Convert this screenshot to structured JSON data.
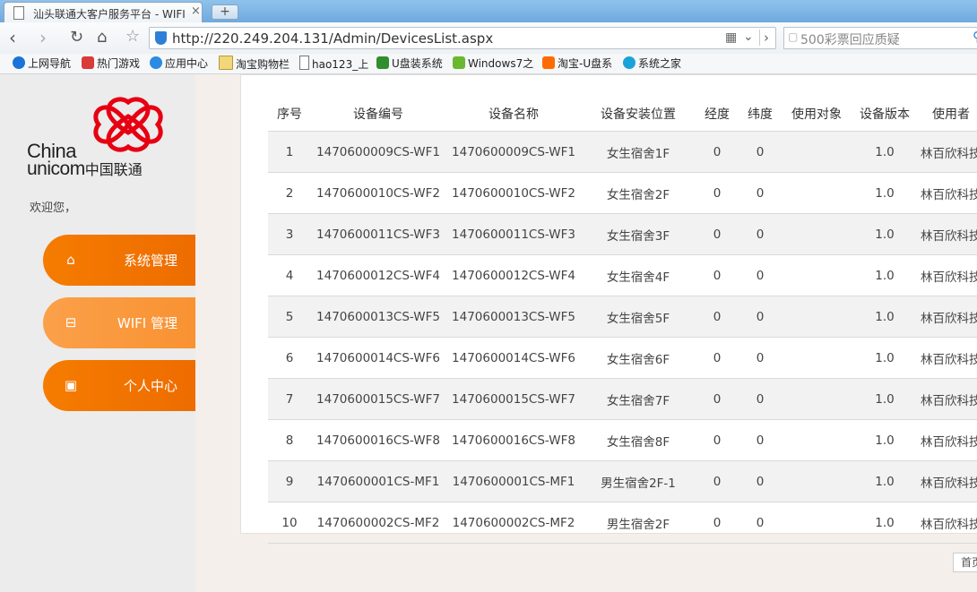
{
  "browser": {
    "tab_title": "汕头联通大客户服务平台 - WIFI",
    "tab_close": "×",
    "new_tab": "+",
    "url": "http://220.249.204.131/Admin/DevicesList.aspx",
    "search_placeholder": "500彩票回应质疑",
    "bookmarks": [
      {
        "label": "上网导航",
        "color": "#1a73d9"
      },
      {
        "label": "热门游戏",
        "color": "#d93a3a"
      },
      {
        "label": "应用中心",
        "color": "#2a8be0"
      },
      {
        "label": "淘宝购物栏",
        "color": "#f1d67a"
      },
      {
        "label": "hao123_上",
        "color": "#ffffff"
      },
      {
        "label": "U盘装系统",
        "color": "#2f8f2f"
      },
      {
        "label": "Windows7之",
        "color": "#6ab82f"
      },
      {
        "label": "淘宝-U盘系",
        "color": "#ff6a00"
      },
      {
        "label": "系统之家",
        "color": "#1aa3d9"
      }
    ]
  },
  "sidebar": {
    "logo_china": "China",
    "logo_unicom": "unicom",
    "logo_cn": "中国联通",
    "welcome": "欢迎您，",
    "menu": [
      {
        "label": "系统管理",
        "icon": "home-icon",
        "glyph": "⌂"
      },
      {
        "label": "WIFI 管理",
        "icon": "inbox-icon",
        "glyph": "⊟"
      },
      {
        "label": "个人中心",
        "icon": "briefcase-icon",
        "glyph": "▣"
      }
    ]
  },
  "table": {
    "headers": [
      "序号",
      "设备编号",
      "设备名称",
      "设备安装位置",
      "经度",
      "纬度",
      "使用对象",
      "设备版本",
      "使用者"
    ],
    "rows": [
      [
        "1",
        "1470600009CS-WF1",
        "1470600009CS-WF1",
        "女生宿舍1F",
        "0",
        "0",
        "",
        "1.0",
        "林百欣科技中"
      ],
      [
        "2",
        "1470600010CS-WF2",
        "1470600010CS-WF2",
        "女生宿舍2F",
        "0",
        "0",
        "",
        "1.0",
        "林百欣科技中"
      ],
      [
        "3",
        "1470600011CS-WF3",
        "1470600011CS-WF3",
        "女生宿舍3F",
        "0",
        "0",
        "",
        "1.0",
        "林百欣科技中"
      ],
      [
        "4",
        "1470600012CS-WF4",
        "1470600012CS-WF4",
        "女生宿舍4F",
        "0",
        "0",
        "",
        "1.0",
        "林百欣科技中"
      ],
      [
        "5",
        "1470600013CS-WF5",
        "1470600013CS-WF5",
        "女生宿舍5F",
        "0",
        "0",
        "",
        "1.0",
        "林百欣科技中"
      ],
      [
        "6",
        "1470600014CS-WF6",
        "1470600014CS-WF6",
        "女生宿舍6F",
        "0",
        "0",
        "",
        "1.0",
        "林百欣科技中"
      ],
      [
        "7",
        "1470600015CS-WF7",
        "1470600015CS-WF7",
        "女生宿舍7F",
        "0",
        "0",
        "",
        "1.0",
        "林百欣科技中"
      ],
      [
        "8",
        "1470600016CS-WF8",
        "1470600016CS-WF8",
        "女生宿舍8F",
        "0",
        "0",
        "",
        "1.0",
        "林百欣科技中"
      ],
      [
        "9",
        "1470600001CS-MF1",
        "1470600001CS-MF1",
        "男生宿舍2F-1",
        "0",
        "0",
        "",
        "1.0",
        "林百欣科技中"
      ],
      [
        "10",
        "1470600002CS-MF2",
        "1470600002CS-MF2",
        "男生宿舍2F",
        "0",
        "0",
        "",
        "1.0",
        "林百欣科技中"
      ]
    ]
  },
  "pager": {
    "first": "首页"
  },
  "colors": {
    "accent": "#f57c00",
    "accent_light": "#fba04a",
    "unicom_red": "#e60012"
  }
}
